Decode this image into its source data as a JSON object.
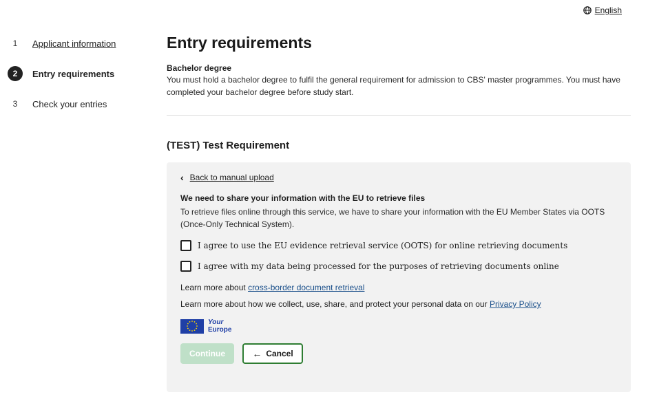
{
  "language": {
    "label": "English",
    "icon": "globe-icon"
  },
  "steps": [
    {
      "number": "1",
      "label": "Applicant information",
      "state": "done"
    },
    {
      "number": "2",
      "label": "Entry requirements",
      "state": "active"
    },
    {
      "number": "3",
      "label": "Check your entries",
      "state": "upcoming"
    }
  ],
  "page": {
    "title": "Entry requirements",
    "section_title": "Bachelor degree",
    "section_text": "You must hold a bachelor degree to fulfil the general requirement for admission to CBS' master programmes. You must have completed your bachelor degree before study start.",
    "requirement_title": "(TEST) Test Requirement"
  },
  "panel": {
    "back_label": "Back to manual upload",
    "title": "We need to share your information with the EU to retrieve files",
    "text": "To retrieve files online through this service, we have to share your information with the EU Member States via OOTS (Once-Only Technical System).",
    "checkbox1": "I agree to use the EU evidence retrieval service (OOTS) for online retrieving documents",
    "checkbox2": "I agree with my data being processed for the purposes of retrieving documents online",
    "learn1_prefix": "Learn more about ",
    "learn1_link": "cross-border document retrieval",
    "learn2_prefix": "Learn more about how we collect, use, share, and protect your personal data on our ",
    "learn2_link": "Privacy Policy",
    "logo_your": "Your",
    "logo_europe": "Europe",
    "continue_label": "Continue",
    "cancel_label": "Cancel"
  },
  "colors": {
    "accent": "#2e7d32",
    "continue_disabled": "#bfe0c8",
    "eu_blue": "#1f3fa6",
    "panel_bg": "#f2f2f2"
  }
}
